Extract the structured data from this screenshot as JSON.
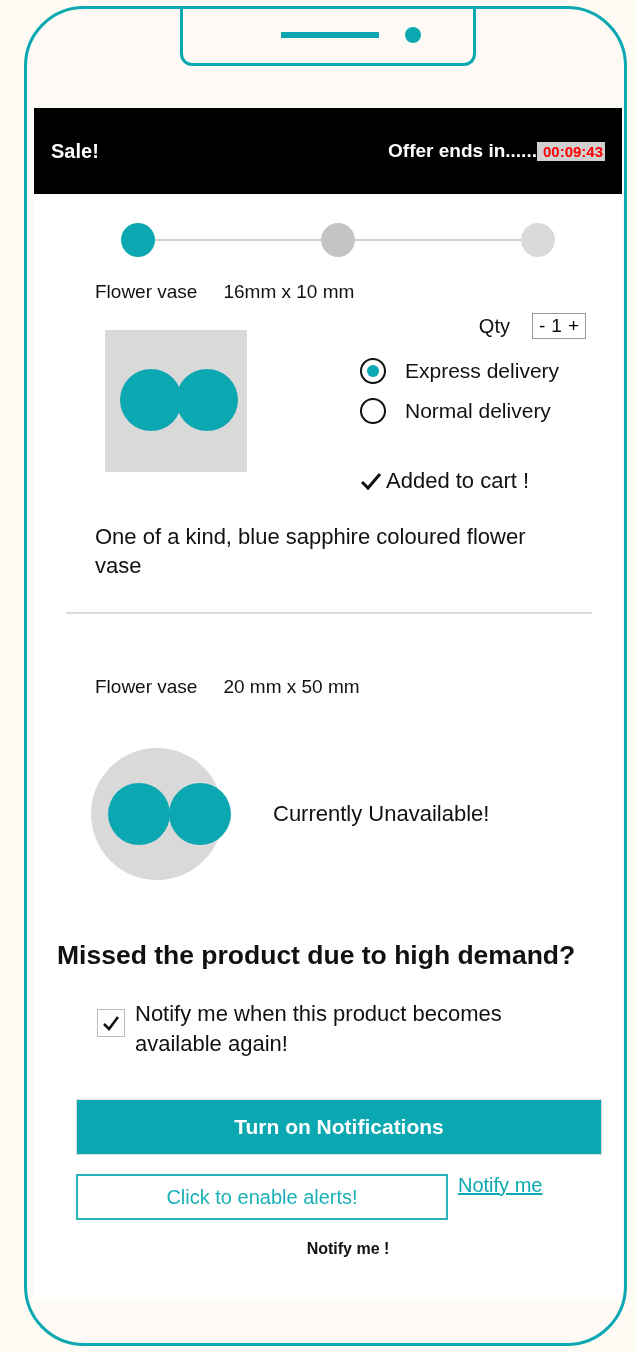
{
  "header": {
    "title": "Sale!",
    "offer_label": "Offer ends in......",
    "timer": "00:09:43"
  },
  "steps": [
    {
      "color": "#0ca8b2"
    },
    {
      "color": "#c4c4c4"
    },
    {
      "color": "#d9d9d9"
    }
  ],
  "products": [
    {
      "kind": "in_stock",
      "name": "Flower vase",
      "size": "16mm x 10 mm",
      "qty_label": "Qty",
      "qty": {
        "minus": "-",
        "value": "1",
        "plus": "+"
      },
      "delivery_options": [
        {
          "label": "Express delivery",
          "selected": true
        },
        {
          "label": "Normal delivery",
          "selected": false
        }
      ],
      "cart_status": "Added to cart !",
      "description": "One of a kind, blue sapphire coloured flower vase"
    },
    {
      "kind": "unavailable",
      "name": "Flower vase",
      "size": "20 mm x 50 mm",
      "status": "Currently Unavailable!"
    }
  ],
  "notify": {
    "heading": "Missed the product due to high demand?",
    "checkbox": {
      "label": "Notify me when this product becomes available again!",
      "checked": true
    },
    "primary_button": "Turn on Notifications",
    "secondary_button": "Click to enable alerts!",
    "link": "Notify me",
    "footer_text": "Notify me !"
  }
}
